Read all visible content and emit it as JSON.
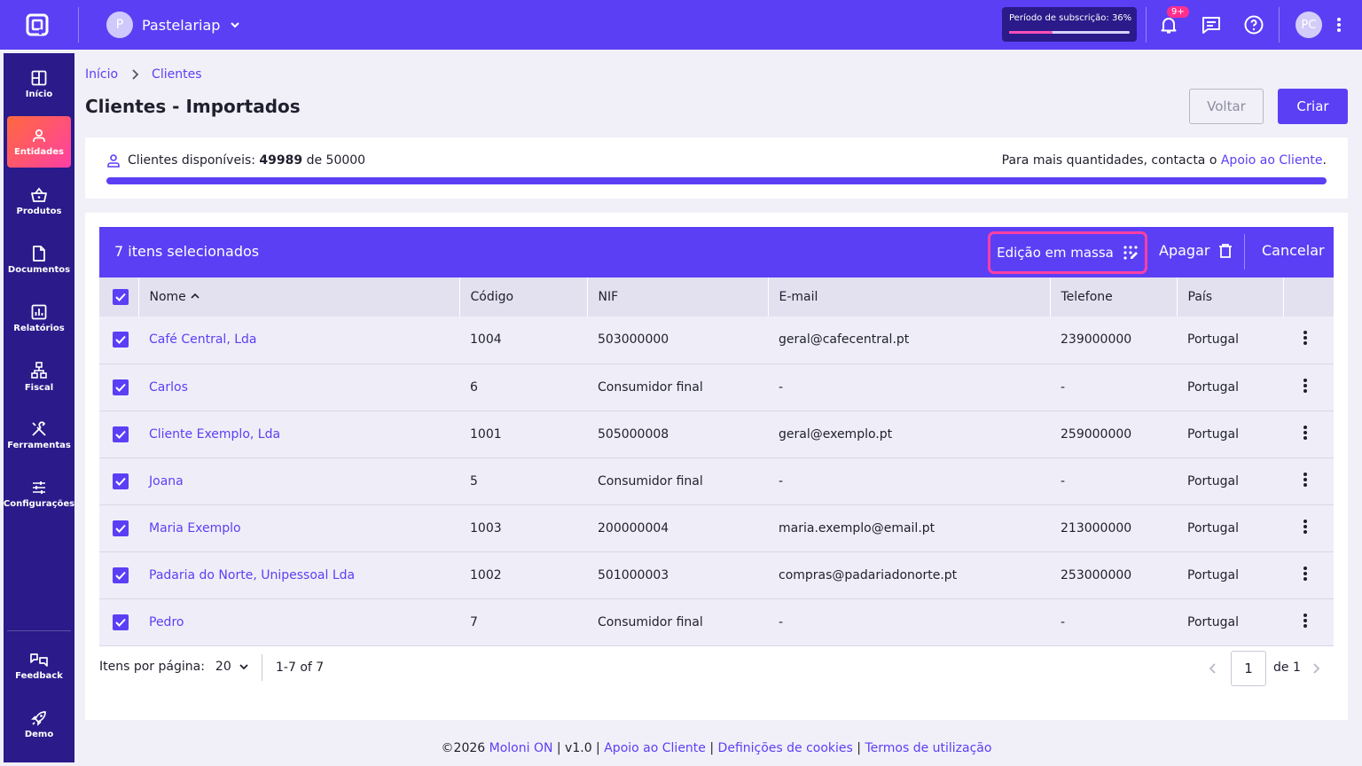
{
  "topbar": {
    "company": "Pastelariap",
    "company_initial": "P",
    "subscription_label": "Período de subscrição: 36%",
    "subscription_progress": 0.36,
    "notifications_badge": "9+",
    "user_initials": "PC"
  },
  "sidebar": {
    "items": [
      {
        "label": "Início",
        "icon": "dashboard-icon"
      },
      {
        "label": "Entidades",
        "icon": "person-icon"
      },
      {
        "label": "Produtos",
        "icon": "basket-icon"
      },
      {
        "label": "Documentos",
        "icon": "document-icon"
      },
      {
        "label": "Relatórios",
        "icon": "chart-icon"
      },
      {
        "label": "Fiscal",
        "icon": "fiscal-icon"
      },
      {
        "label": "Ferramentas",
        "icon": "tools-icon"
      },
      {
        "label": "Configurações",
        "icon": "sliders-icon"
      }
    ],
    "bottom": [
      {
        "label": "Feedback",
        "icon": "feedback-icon"
      },
      {
        "label": "Demo",
        "icon": "rocket-icon"
      }
    ]
  },
  "breadcrumb": {
    "home": "Início",
    "current": "Clientes"
  },
  "page": {
    "title": "Clientes - Importados",
    "back_label": "Voltar",
    "create_label": "Criar"
  },
  "availability": {
    "prefix": "Clientes disponíveis: ",
    "available": "49989",
    "middle": " de ",
    "total": "50000",
    "contact_text": "Para mais quantidades, contacta o ",
    "contact_link": "Apoio ao Cliente",
    "contact_end": ".",
    "fill": 0.9998
  },
  "selection": {
    "count_label": "7 itens selecionados",
    "mass_edit": "Edição em massa",
    "delete": "Apagar",
    "cancel": "Cancelar"
  },
  "table": {
    "headers": {
      "name": "Nome",
      "code": "Código",
      "nif": "NIF",
      "email": "E-mail",
      "phone": "Telefone",
      "country": "País"
    },
    "rows": [
      {
        "name": "Café Central, Lda",
        "code": "1004",
        "nif": "503000000",
        "email": "geral@cafecentral.pt",
        "phone": "239000000",
        "country": "Portugal"
      },
      {
        "name": "Carlos",
        "code": "6",
        "nif": "Consumidor final",
        "email": "-",
        "phone": "-",
        "country": "Portugal"
      },
      {
        "name": "Cliente Exemplo, Lda",
        "code": "1001",
        "nif": "505000008",
        "email": "geral@exemplo.pt",
        "phone": "259000000",
        "country": "Portugal"
      },
      {
        "name": "Joana",
        "code": "5",
        "nif": "Consumidor final",
        "email": "-",
        "phone": "-",
        "country": "Portugal"
      },
      {
        "name": "Maria Exemplo",
        "code": "1003",
        "nif": "200000004",
        "email": "maria.exemplo@email.pt",
        "phone": "213000000",
        "country": "Portugal"
      },
      {
        "name": "Padaria do Norte, Unipessoal Lda",
        "code": "1002",
        "nif": "501000003",
        "email": "compras@padariadonorte.pt",
        "phone": "253000000",
        "country": "Portugal"
      },
      {
        "name": "Pedro",
        "code": "7",
        "nif": "Consumidor final",
        "email": "-",
        "phone": "-",
        "country": "Portugal"
      }
    ]
  },
  "pagination": {
    "items_per_page_label": "Itens por página:",
    "items_per_page": "20",
    "range": "1-7 of 7",
    "page": "1",
    "of_pages": "de 1"
  },
  "footer": {
    "copyright": "©2026 ",
    "brand": "Moloni ON",
    "version": " | v1.0 | ",
    "support": "Apoio ao Cliente",
    "sep1": " | ",
    "cookies": "Definições de cookies",
    "sep2": " | ",
    "terms": "Termos de utilização"
  },
  "colors": {
    "primary": "#5b3ff5",
    "sidebar": "#2a1a8a",
    "accent": "#ff3fa4"
  }
}
